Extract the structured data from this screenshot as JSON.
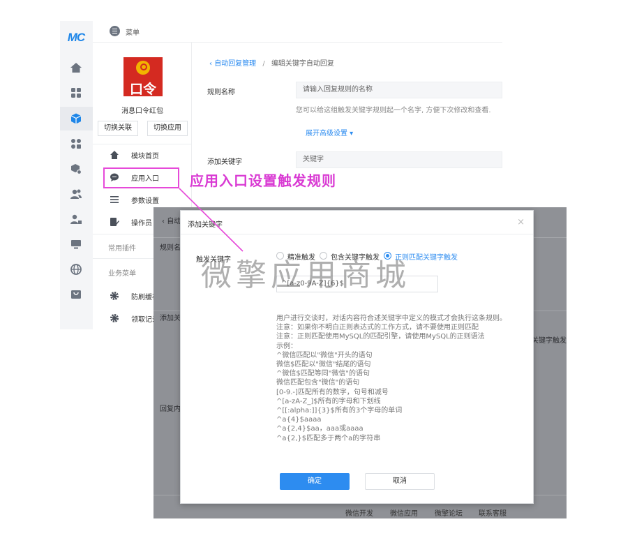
{
  "brand": {
    "logo_text": "MC"
  },
  "header": {
    "menu_label": "菜单"
  },
  "module": {
    "logo_text": "口令",
    "name": "消息口令红包",
    "switch_link": "切换关联",
    "switch_app": "切换应用"
  },
  "sidebar": {
    "items": [
      {
        "label": "模块首页",
        "icon": "home-icon"
      },
      {
        "label": "应用入口",
        "icon": "chat-bubble-icon"
      },
      {
        "label": "参数设置",
        "icon": "list-icon"
      },
      {
        "label": "操作员",
        "icon": "edit-icon"
      }
    ],
    "section_plugins": "常用插件",
    "section_business": "业务菜单",
    "business_items": [
      {
        "label": "防刷缓存",
        "icon": "gear-icon"
      },
      {
        "label": "领取记录",
        "icon": "gear-icon"
      }
    ]
  },
  "annotation": {
    "text": "应用入口设置触发规则"
  },
  "main": {
    "breadcrumb_parent": "自动回复管理",
    "breadcrumb_current": "编辑关键字自动回复",
    "rule_name_label": "规则名称",
    "rule_name_placeholder": "请输入回复规则的名称",
    "rule_name_help": "您可以给这组触发关键字规则起一个名字, 方便下次修改和查看.",
    "advanced_link": "展开高级设置",
    "add_keyword_label": "添加关键字",
    "keyword_placeholder": "关键字"
  },
  "underlay": {
    "crumb": "自动",
    "rule_label": "规则名",
    "add_label": "添加关",
    "reply_label": "回复内",
    "right_text": "正则匹配关键字触发"
  },
  "modal": {
    "title": "添加关键字",
    "close": "×",
    "trigger_label": "触发关键字",
    "radio_exact": "精准触发",
    "radio_contains": "包含关键字触发",
    "radio_regex": "正则匹配关键字触发",
    "regex_value": "^[a-z0-9A-Z]{6}$",
    "rules": [
      "用户进行交谈时，对话内容符合述关键字中定义的模式才会执行这条规则。",
      "注意：如果你不明白正则表达式的工作方式，请不要使用正则匹配",
      "注意：正则匹配使用MySQL的匹配引擎，请使用MySQL的正则语法",
      "示例：",
      "^微信匹配以\"微信\"开头的语句",
      "微信$匹配以\"微信\"结尾的语句",
      "^微信$匹配等同\"微信\"的语句",
      "微信匹配包含\"微信\"的语句",
      "[0-9.-]匹配所有的数字，句号和减号",
      "^[a-zA-Z_]$所有的字母和下划线",
      "^[[:alpha:]]{3}$所有的3个字母的单词",
      "^a{4}$aaaa",
      "^a{2,4}$aa，aaa或aaaa",
      "^a{2,}$匹配多于两个a的字符串"
    ],
    "confirm": "确定",
    "cancel": "取消"
  },
  "watermark": {
    "text": "微擎应用商城"
  },
  "footer": {
    "links": [
      "微信开发",
      "微信应用",
      "微擎论坛",
      "联系客服"
    ]
  },
  "colors": {
    "primary": "#2d8cf0",
    "annotation": "#d93ad3",
    "logo_red": "#d42a21",
    "overlay": "#8f9196"
  }
}
